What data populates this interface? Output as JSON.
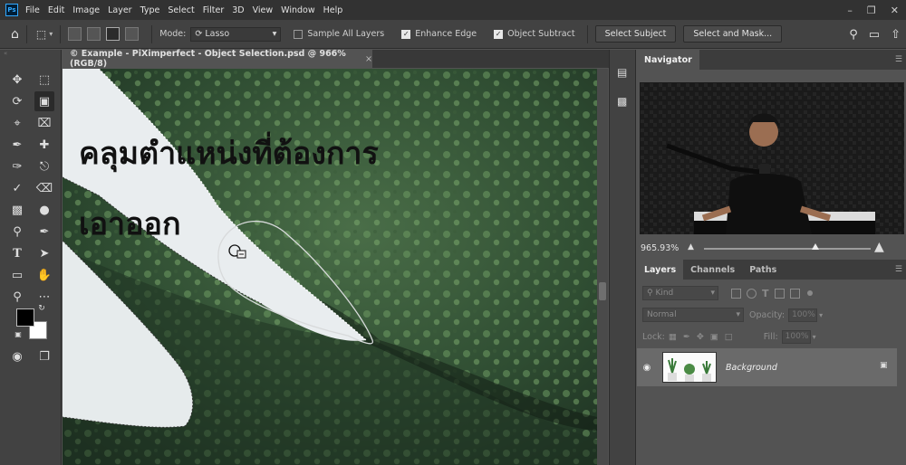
{
  "menu": {
    "logo": "Ps",
    "items": [
      "File",
      "Edit",
      "Image",
      "Layer",
      "Type",
      "Select",
      "Filter",
      "3D",
      "View",
      "Window",
      "Help"
    ],
    "window_controls": [
      "minimize-icon",
      "restore-icon",
      "close-icon"
    ]
  },
  "options": {
    "mode_label": "Mode:",
    "mode_value": "Lasso",
    "sample_all_layers": {
      "label": "Sample All Layers",
      "checked": false
    },
    "enhance_edge": {
      "label": "Enhance Edge",
      "checked": true
    },
    "object_subtract": {
      "label": "Object Subtract",
      "checked": true
    },
    "select_subject_label": "Select Subject",
    "select_and_mask_label": "Select and Mask..."
  },
  "document": {
    "tab_title": "© Example - PiXimperfect - Object Selection.psd @ 966% (RGB/8)",
    "close_glyph": "×"
  },
  "caption": {
    "line1": "คลุมตำแหน่งที่ต้องการ",
    "line2": "เอาออก"
  },
  "navigator": {
    "tab_label": "Navigator",
    "zoom_value": "965.93%",
    "zoom_fraction": 0.67
  },
  "layers_panel": {
    "tabs": [
      "Layers",
      "Channels",
      "Paths"
    ],
    "active_tab": "Layers",
    "kind_label": "Kind",
    "blend_mode": "Normal",
    "opacity_label": "Opacity:",
    "opacity_value": "100%",
    "lock_label": "Lock:",
    "fill_label": "Fill:",
    "fill_value": "100%",
    "layers": [
      {
        "name": "Background",
        "visible": true,
        "locked": true
      }
    ]
  },
  "colors": {
    "foreground": "#000000",
    "background": "#ffffff"
  }
}
